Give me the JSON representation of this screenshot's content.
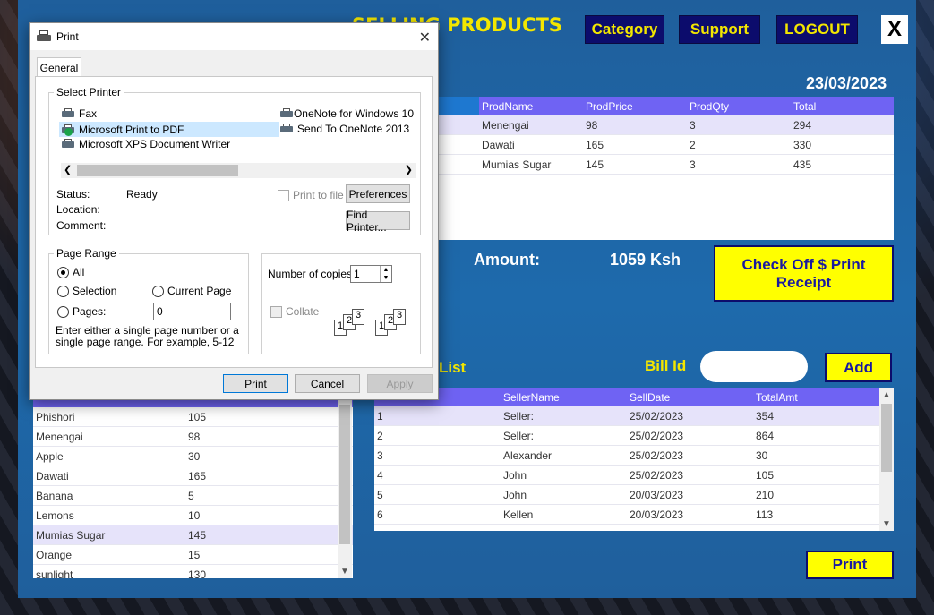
{
  "app": {
    "title": "SELLING PRODUCTS",
    "nav": {
      "category": "Category",
      "support": "Support",
      "logout": "LOGOUT",
      "close": "X"
    },
    "date": "23/03/2023"
  },
  "bill_grid": {
    "columns": [
      "ProdName",
      "ProdPrice",
      "ProdQty",
      "Total"
    ],
    "rows": [
      [
        "Menengai",
        "98",
        "3",
        "294"
      ],
      [
        "Dawati",
        "165",
        "2",
        "330"
      ],
      [
        "Mumias Sugar",
        "145",
        "3",
        "435"
      ]
    ]
  },
  "amount": {
    "label": "Amount:",
    "value": "1059 Ksh"
  },
  "checkout_button": "Check Off $ Print Receipt",
  "bills_list": {
    "label": "List",
    "bill_id_label": "Bill Id",
    "add_button": "Add",
    "print_button": "Print"
  },
  "bills_grid": {
    "columns": [
      "",
      "SellerName",
      "SellDate",
      "TotalAmt"
    ],
    "rows": [
      [
        "1",
        "Seller:",
        "25/02/2023",
        "354"
      ],
      [
        "2",
        "Seller:",
        "25/02/2023",
        "864"
      ],
      [
        "3",
        "Alexander",
        "25/02/2023",
        "30"
      ],
      [
        "4",
        "John",
        "25/02/2023",
        "105"
      ],
      [
        "5",
        "John",
        "20/03/2023",
        "210"
      ],
      [
        "6",
        "Kellen",
        "20/03/2023",
        "113"
      ]
    ]
  },
  "products_grid": {
    "rows": [
      [
        "Phishori",
        "105"
      ],
      [
        "Menengai",
        "98"
      ],
      [
        "Apple",
        "30"
      ],
      [
        "Dawati",
        "165"
      ],
      [
        "Banana",
        "5"
      ],
      [
        "Lemons",
        "10"
      ],
      [
        "Mumias Sugar",
        "145"
      ],
      [
        "Orange",
        "15"
      ],
      [
        "sunlight",
        "130"
      ]
    ]
  },
  "print_dialog": {
    "title": "Print",
    "tab": "General",
    "select_printer_label": "Select Printer",
    "printers": {
      "fax": "Fax",
      "pdf": "Microsoft Print to PDF",
      "xps": "Microsoft XPS Document Writer",
      "onenote10": "OneNote for Windows 10",
      "send_onenote": "Send To OneNote 2013"
    },
    "status_label": "Status:",
    "status_value": "Ready",
    "location_label": "Location:",
    "comment_label": "Comment:",
    "print_to_file": "Print to file",
    "preferences": "Preferences",
    "find_printer": "Find Printer...",
    "page_range_label": "Page Range",
    "ranges": {
      "all": "All",
      "selection": "Selection",
      "current_page": "Current Page",
      "pages": "Pages:"
    },
    "pages_value": "0",
    "range_hint": "Enter either a single page number or a single page range.  For example, 5-12",
    "copies_label": "Number of copies:",
    "copies_value": "1",
    "collate": "Collate",
    "buttons": {
      "print": "Print",
      "cancel": "Cancel",
      "apply": "Apply"
    }
  }
}
